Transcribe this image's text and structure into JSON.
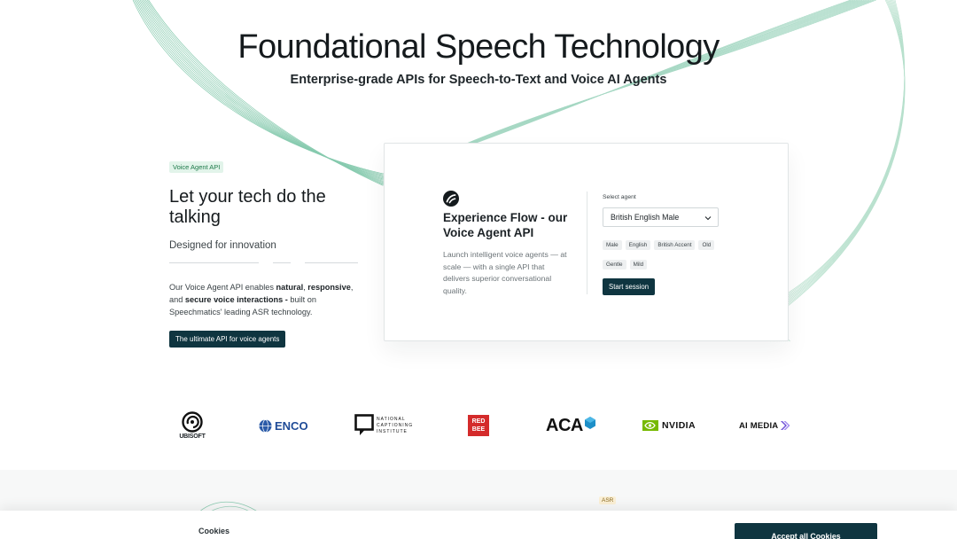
{
  "hero": {
    "title": "Foundational Speech Technology",
    "subtitle": "Enterprise-grade APIs for Speech-to-Text and Voice AI Agents"
  },
  "voice_agent": {
    "tag": "Voice Agent API",
    "title": "Let your tech do the talking",
    "tagline": "Designed for innovation",
    "body": {
      "p1": "Our Voice Agent API enables ",
      "natural": "natural",
      "comma": ", ",
      "responsive": "responsive",
      "p2": ", and ",
      "secure": "secure voice interactions - ",
      "p3": "built on Speechmatics' leading ASR technology."
    },
    "cta_label": "The ultimate API for voice agents"
  },
  "demo": {
    "logo_icon": "flow-logo-icon",
    "title": "Experience Flow - our Voice Agent API",
    "description": "Launch intelligent voice agents — at scale — with a single API that delivers superior conversational quality.",
    "select_label": "Select agent",
    "selected_agent": "British English Male",
    "chips": [
      "Male",
      "English",
      "British Accent",
      "Old",
      "Gentle",
      "Mild"
    ],
    "start_label": "Start session"
  },
  "logos": {
    "ubisoft": "UBISOFT",
    "enco": "ENCO",
    "nci_lines": [
      "NATIONAL",
      "CAPTIONING",
      "INSTITUTE"
    ],
    "redbee_lines": [
      "RED",
      "BEE"
    ],
    "aca": "ACA",
    "nvidia": "NVIDIA",
    "aimedia": "AI MEDIA"
  },
  "section_tag": "ASR",
  "cookie": {
    "label": "Cookies",
    "accept_label": "Accept all Cookies"
  },
  "colors": {
    "accent_dark": "#0f3540",
    "curve_green": "#5fb994",
    "tag_green_bg": "#e2f4ea",
    "nvidia_green": "#76b900",
    "redbee_red": "#d42b2b",
    "aca_blue": "#1d8fc8"
  }
}
